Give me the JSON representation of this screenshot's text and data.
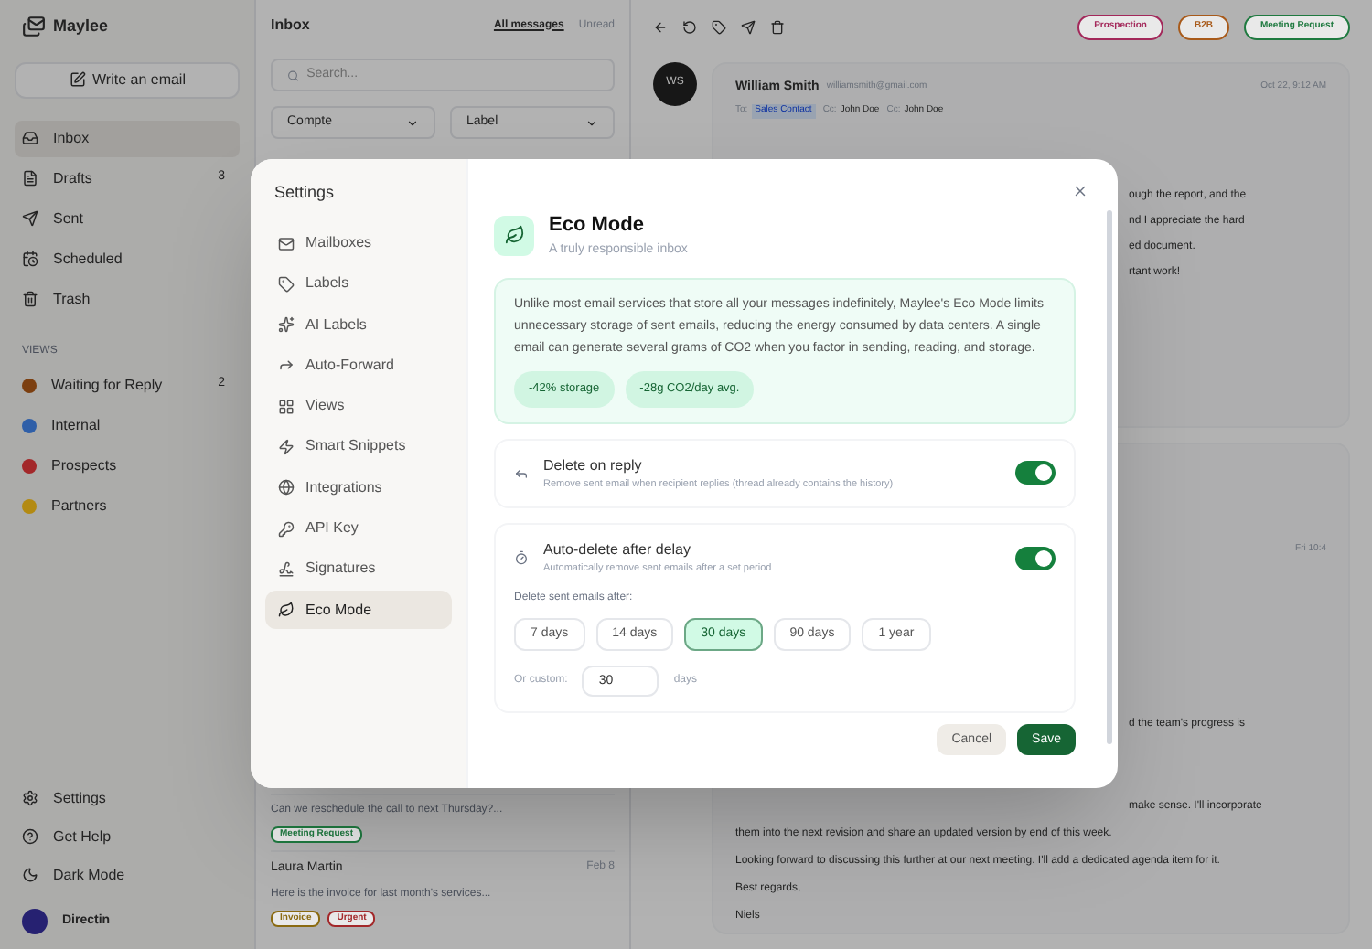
{
  "app": {
    "name": "Maylee"
  },
  "sidebar": {
    "compose": "Write an email",
    "nav": [
      {
        "label": "Inbox",
        "selected": true
      },
      {
        "label": "Drafts",
        "selected": false,
        "count": "3"
      },
      {
        "label": "Sent",
        "selected": false
      },
      {
        "label": "Scheduled",
        "selected": false
      },
      {
        "label": "Trash",
        "selected": false
      }
    ],
    "views_heading": "VIEWS",
    "views": [
      {
        "label": "Waiting for Reply",
        "color": "#7c3f10",
        "count": "2"
      },
      {
        "label": "Internal",
        "color": "#2f5fa8"
      },
      {
        "label": "Prospects",
        "color": "#a3282a"
      },
      {
        "label": "Partners",
        "color": "#b38a12"
      }
    ],
    "bottom": [
      {
        "label": "Settings"
      },
      {
        "label": "Get Help"
      },
      {
        "label": "Dark Mode"
      }
    ],
    "user": {
      "name": "Directin"
    }
  },
  "list": {
    "title": "Inbox",
    "tabs": [
      {
        "label": "All messages",
        "selected": true
      },
      {
        "label": "Unread",
        "selected": false
      }
    ],
    "search": {
      "placeholder": "Search..."
    },
    "filters": [
      "Compte",
      "Label"
    ],
    "items": [
      {
        "preview": "Can we reschedule the call to next Thursday?...",
        "tags": [
          {
            "label": "Meeting Request",
            "color": "#1f7a40"
          }
        ]
      },
      {
        "sender": "Laura Martin",
        "date": "Feb 8",
        "preview": "Here is the invoice for last month's services...",
        "tags": [
          {
            "label": "Invoice",
            "color": "#8a6a10"
          },
          {
            "label": "Urgent",
            "color": "#a3282a"
          }
        ]
      }
    ]
  },
  "reader": {
    "tags": [
      {
        "label": "Prospection",
        "color": "#a3285a"
      },
      {
        "label": "B2B",
        "color": "#a85a1a"
      },
      {
        "label": "Meeting Request",
        "color": "#1f7a40"
      }
    ],
    "avatar": "WS",
    "sender": "William Smith",
    "email": "williamsmith@gmail.com",
    "date": "Oct 22, 9:12 AM",
    "recipients": [
      {
        "prefix": "To:",
        "name": "Sales Contact"
      },
      {
        "prefix": "Cc:",
        "name": "John Doe"
      },
      {
        "prefix": "Cc:",
        "name": "John Doe"
      }
    ],
    "body_fragments": [
      "ough the report, and the",
      "nd I appreciate the hard",
      "ed document.",
      "rtant work!"
    ],
    "second_date": "Fri 10:4",
    "second_fragments": [
      "d the team's progress is",
      "make sense. I'll incorporate"
    ],
    "second_body": [
      "them into the next revision and share an updated version by end of this week.",
      "Looking forward to discussing this further at our next meeting. I'll add a dedicated agenda item for it.",
      "Best regards,",
      "Niels"
    ]
  },
  "settings": {
    "title": "Settings",
    "nav": [
      {
        "label": "Mailboxes",
        "selected": false
      },
      {
        "label": "Labels",
        "selected": false
      },
      {
        "label": "AI Labels",
        "selected": false
      },
      {
        "label": "Auto-Forward",
        "selected": false
      },
      {
        "label": "Views",
        "selected": false
      },
      {
        "label": "Smart Snippets",
        "selected": false
      },
      {
        "label": "Integrations",
        "selected": false
      },
      {
        "label": "API Key",
        "selected": false
      },
      {
        "label": "Signatures",
        "selected": false
      },
      {
        "label": "Eco Mode",
        "selected": true
      }
    ],
    "page": {
      "title": "Eco Mode",
      "subtitle": "A truly responsible inbox",
      "info": "Unlike most email services that store all your messages indefinitely, Maylee's Eco Mode limits unnecessary storage of sent emails, reducing the energy consumed by data centers. A single email can generate several grams of CO2 when you factor in sending, reading, and storage.",
      "stats": [
        "-42% storage",
        "-28g CO2/day avg."
      ],
      "options": [
        {
          "title": "Delete on reply",
          "description": "Remove sent email when recipient replies (thread already contains the history)",
          "on": true
        },
        {
          "title": "Auto-delete after delay",
          "description": "Automatically remove sent emails after a set period",
          "on": true,
          "delay": {
            "label": "Delete sent emails after:",
            "choices": [
              {
                "label": "7 days",
                "selected": false
              },
              {
                "label": "14 days",
                "selected": false
              },
              {
                "label": "30 days",
                "selected": true
              },
              {
                "label": "90 days",
                "selected": false
              },
              {
                "label": "1 year",
                "selected": false
              }
            ],
            "custom_label": "Or custom:",
            "custom_value": "30",
            "custom_unit": "days"
          }
        }
      ],
      "buttons": {
        "cancel": "Cancel",
        "save": "Save"
      }
    }
  }
}
